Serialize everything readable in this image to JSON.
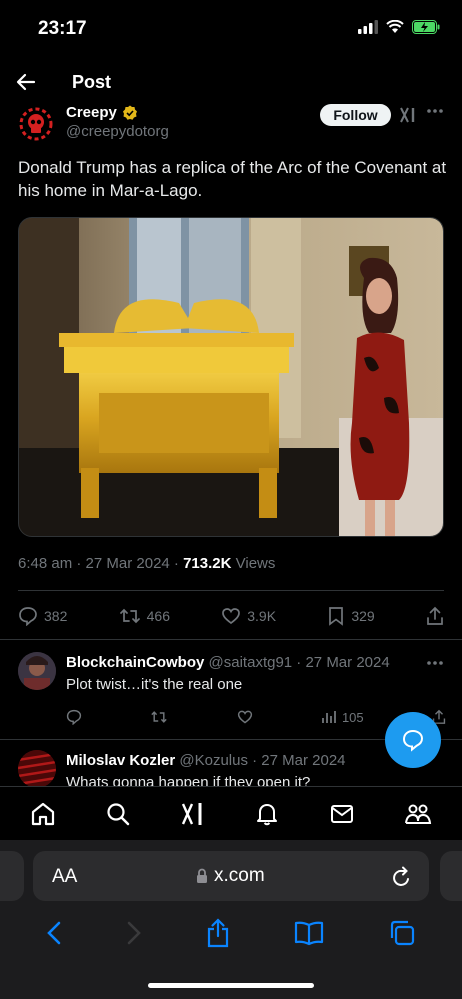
{
  "status_bar": {
    "time": "23:17"
  },
  "header": {
    "title": "Post"
  },
  "author": {
    "name": "Creepy",
    "handle": "@creepydotorg",
    "follow_label": "Follow"
  },
  "tweet": {
    "text": "Donald Trump has a replica of the Arc of the Covenant at his home in Mar-a-Lago.",
    "time": "6:48 am · 27 Mar 2024 · ",
    "views_count": "713.2K",
    "views_label": " Views"
  },
  "actions": {
    "replies": "382",
    "reposts": "466",
    "likes": "3.9K",
    "bookmarks": "329"
  },
  "replies": [
    {
      "name": "BlockchainCowboy",
      "meta": " @saitaxtg91 · 27 Mar 2024",
      "text": "Plot twist…it's the real one",
      "views": "105"
    },
    {
      "name": "Miloslav Kozler",
      "meta": " @Kozulus · 27 Mar 2024",
      "text": "Whats gonna happen if  they open it?"
    }
  ],
  "browser": {
    "text_size": "AA",
    "url": "x.com"
  },
  "colors": {
    "accent": "#1d9bf0",
    "background": "#000000",
    "verified_gold": "#e2b719"
  }
}
